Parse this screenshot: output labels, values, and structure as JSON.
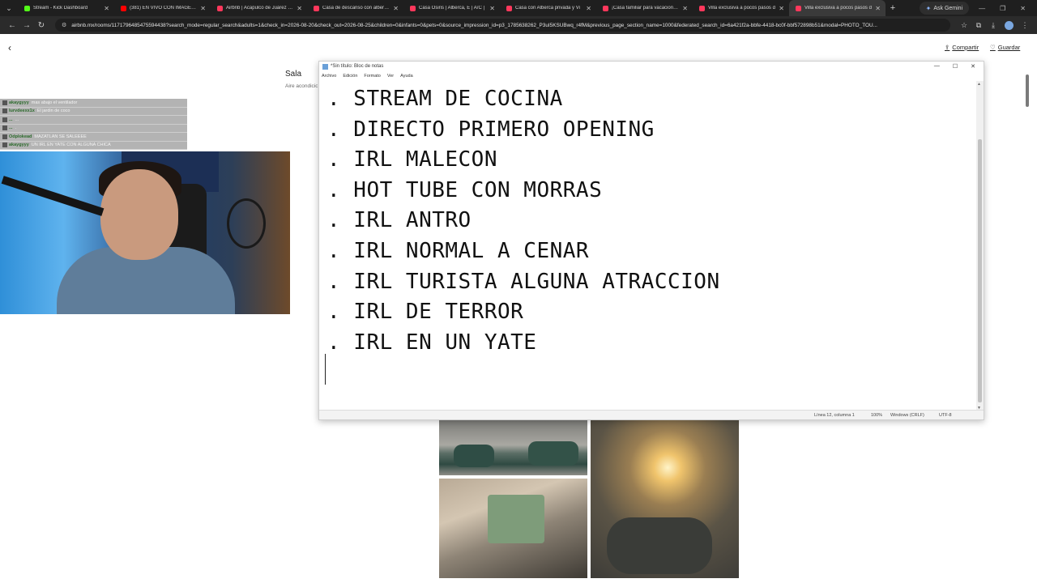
{
  "browser": {
    "tabs": [
      {
        "title": "Stream - Kick Dashboard",
        "color": "#53fc18"
      },
      {
        "title": "(381) EN VIVO CON IMAGEN: C",
        "color": "#ff0000"
      },
      {
        "title": "Airbnb | Acapulco de Juárez - A",
        "color": "#ff385c"
      },
      {
        "title": "Casa de descanso con alberca!",
        "color": "#ff385c"
      },
      {
        "title": "Casa Osiris | Alberca, E | A/C |",
        "color": "#ff385c"
      },
      {
        "title": "Casa con Alberca privada y Vi",
        "color": "#ff385c"
      },
      {
        "title": "¡Casa familiar para vacacionar c",
        "color": "#ff385c"
      },
      {
        "title": "Villa exclusiva a pocos pasos d",
        "color": "#ff385c"
      },
      {
        "title": "Villa exclusiva a pocos pasos d",
        "color": "#ff385c",
        "active": true
      }
    ],
    "ask_gemini": "Ask Gemini",
    "url": "airbnb.mx/rooms/1171796485475594438?search_mode=regular_search&adults=1&check_in=2026-08-20&check_out=2026-08-25&children=0&infants=0&pets=0&source_impression_id=p3_1785638262_P3uI5KSUBwq_r4fM&previous_page_section_name=1000&federated_search_id=6a421f2a-bbfe-4418-bc0f-bbf572898b51&modal=PHOTO_TOU..."
  },
  "airbnb": {
    "share_label": "Compartir",
    "save_label": "Guardar",
    "room_title": "Sala",
    "room_subtitle": "Aire acondicionado"
  },
  "chat": [
    {
      "user": "akaygyyy",
      "msg": "  mas abajo el ventilador"
    },
    {
      "user": "lurvdeexx1x",
      "msg": "  El jardin de coco"
    },
    {
      "user": "...",
      "msg": "  ..."
    },
    {
      "user": "...",
      "msg": "  ."
    },
    {
      "user": "Odplokead",
      "msg": "  MAZATLAN SE SALEEEE"
    },
    {
      "user": "akaygyyy",
      "msg": "  UN IRL EN YATE CON ALGUNA CHICA"
    }
  ],
  "notepad": {
    "title": "*Sin título: Bloc de notas",
    "menu": [
      "Archivo",
      "Edición",
      "Formato",
      "Ver",
      "Ayuda"
    ],
    "lines": [
      ". STREAM DE COCINA",
      ". DIRECTO PRIMERO OPENING",
      ". IRL MALECON",
      ". HOT TUBE CON MORRAS",
      ". IRL ANTRO",
      ". IRL NORMAL A CENAR",
      ". IRL TURISTA ALGUNA ATRACCION",
      ". IRL DE TERROR",
      ". IRL EN UN YATE"
    ],
    "status": {
      "position": "Línea 12, columna 1",
      "zoom": "100%",
      "line_ending": "Windows (CRLF)",
      "encoding": "UTF-8"
    }
  }
}
